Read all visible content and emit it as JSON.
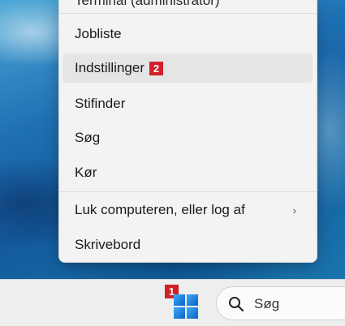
{
  "menu": {
    "cutoff_label": "Terminal (administrator)",
    "items": [
      {
        "label": "Jobliste"
      },
      {
        "label": "Indstillinger",
        "badge": "2"
      },
      {
        "label": "Stifinder"
      },
      {
        "label": "Søg"
      },
      {
        "label": "Kør"
      },
      {
        "label": "Luk computeren, eller log af",
        "chevron": "›"
      },
      {
        "label": "Skrivebord"
      }
    ]
  },
  "taskbar": {
    "start_badge": "1",
    "search_placeholder": "Søg"
  },
  "colors": {
    "badge": "#d0202a",
    "menu_bg": "#f3f3f3",
    "hover_bg": "#e5e5e5"
  }
}
